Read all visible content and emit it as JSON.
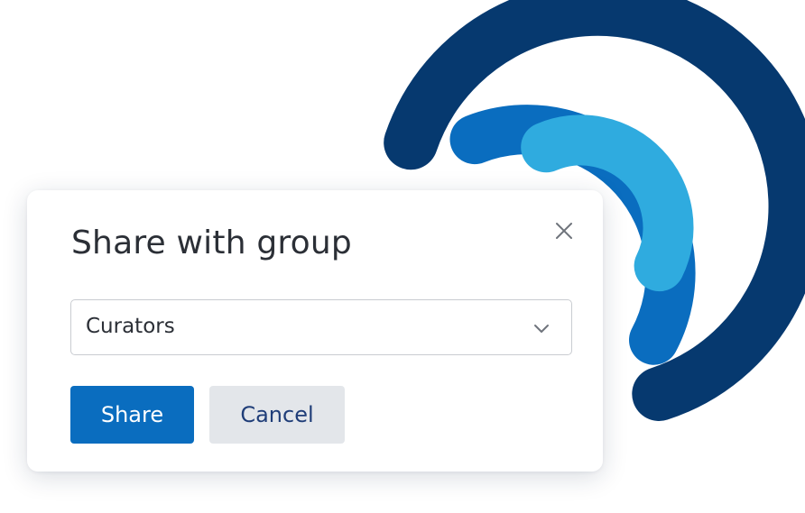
{
  "colors": {
    "arc_outer": "#06396f",
    "arc_middle": "#0a6dbf",
    "arc_inner": "#2fabdf",
    "primary_button": "#0a6dbf",
    "secondary_button": "#e3e6ea",
    "secondary_button_text": "#1f3d78"
  },
  "dialog": {
    "title": "Share with group",
    "close_icon": "close-icon",
    "select": {
      "value": "Curators",
      "icon": "chevron-down-icon"
    },
    "buttons": {
      "share_label": "Share",
      "cancel_label": "Cancel"
    }
  }
}
